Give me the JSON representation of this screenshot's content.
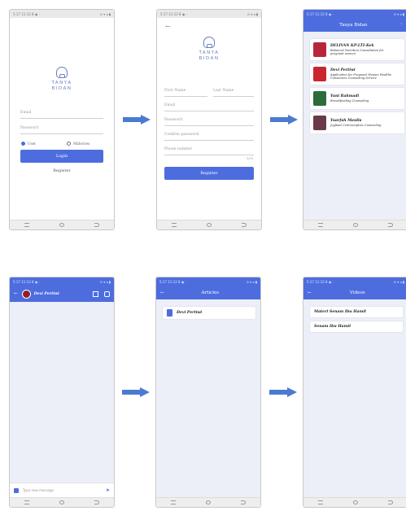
{
  "status": {
    "left": "5:17 11:12 8 ◉ ·",
    "right": "⊙ ▾ ◂ ▮"
  },
  "login": {
    "logo_line1": "TANYA",
    "logo_line2": "BIDAN",
    "email_placeholder": "Email",
    "password_placeholder": "Password",
    "role_user": "User",
    "role_midwife": "Midwives",
    "login_button": "Login",
    "register_link": "Register"
  },
  "register": {
    "back_icon": "←",
    "logo_line1": "TANYA",
    "logo_line2": "BIDAN",
    "first_name": "First Name",
    "last_name": "Last Name",
    "email": "Email",
    "password": "Password",
    "confirm_password": "Confirm password",
    "phone": "Phone number",
    "counter": "0/10",
    "register_button": "Register"
  },
  "topics": {
    "title": "Tanya Bidan",
    "menu_icon": "⋮",
    "items": [
      {
        "title": "DELIVAN KP-LTI-Kek",
        "subtitle": "Balanced Nutrition Consultation for\npregnant women",
        "color": "#b8263b"
      },
      {
        "title": "Devi Pertiwi",
        "subtitle": "Application for Pregnant Women Healthe\nConsumers Counseling Service",
        "color": "#c9272d"
      },
      {
        "title": "Yuni Rahmadi",
        "subtitle": "Breastfeeding Counseling",
        "color": "#2b6b3c"
      },
      {
        "title": "Yuarfah Maulia",
        "subtitle": "Joyfiant Contraceptive Counseling",
        "color": "#6b3a48"
      }
    ]
  },
  "chat": {
    "back_icon": "←",
    "name": "Devi Pertiwi",
    "input_placeholder": "Type new message",
    "send_icon": "➤"
  },
  "articles": {
    "title": "Articles",
    "back_icon": "←",
    "items": [
      {
        "label": "Devi Pertiwi"
      }
    ]
  },
  "videos": {
    "title": "Videos",
    "back_icon": "←",
    "items": [
      {
        "label": "Materi Senam Ibu Hamil"
      },
      {
        "label": "Senam Ibu Hamil"
      }
    ]
  },
  "accent_color": "#4d6ddf"
}
